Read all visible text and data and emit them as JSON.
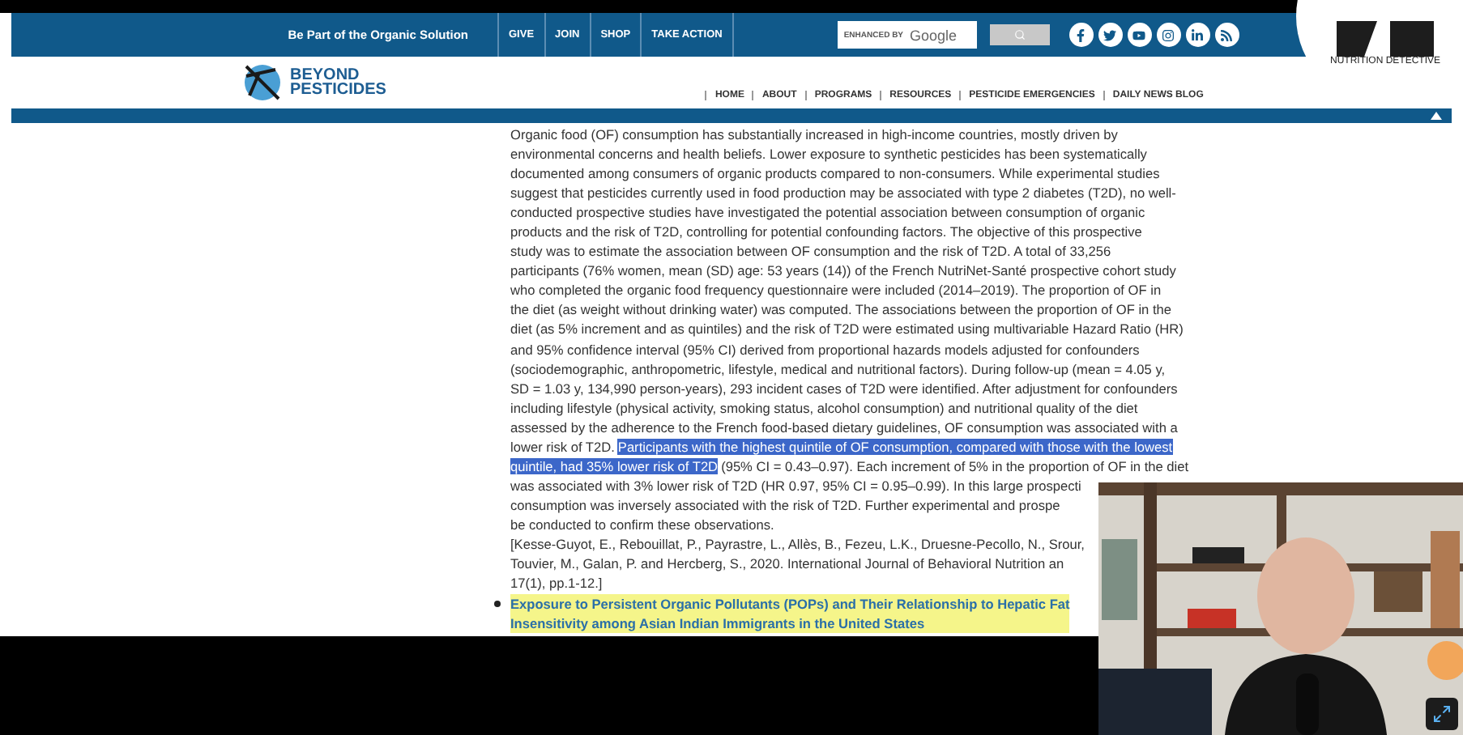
{
  "top_bar": {
    "slogan": "Be Part of the Organic Solution",
    "links": [
      "GIVE",
      "JOIN",
      "SHOP",
      "TAKE ACTION"
    ],
    "search": {
      "hint_label": "ENHANCED BY",
      "hint_brand": "Google"
    }
  },
  "badge": {
    "caption": "NUTRITION DETECTIVE"
  },
  "logo": {
    "line_1": "BEYOND",
    "line_2": "PESTICIDES"
  },
  "nav": [
    "HOME",
    "ABOUT",
    "PROGRAMS",
    "RESOURCES",
    "PESTICIDE EMERGENCIES",
    "DAILY NEWS BLOG"
  ],
  "article": {
    "lines": [
      [
        {
          "text": "Organic food (OF) consumption has substantially increased in high-income countries, mostly driven by",
          "selected": false
        }
      ],
      [
        {
          "text": "environmental concerns and health beliefs. Lower exposure to synthetic pesticides has been systematically",
          "selected": false
        }
      ],
      [
        {
          "text": "documented among consumers of organic products compared to non-consumers. While experimental studies",
          "selected": false
        }
      ],
      [
        {
          "text": "suggest that pesticides currently used in food production may be associated with type 2 diabetes (T2D), no well-",
          "selected": false
        }
      ],
      [
        {
          "text": "conducted prospective studies have investigated the potential association between consumption of organic",
          "selected": false
        }
      ],
      [
        {
          "text": "products and the risk of T2D, controlling for potential confounding factors. The objective of this prospective",
          "selected": false
        }
      ],
      [
        {
          "text": "study was to estimate the association between OF consumption and the risk of T2D. A total of 33,256",
          "selected": false
        }
      ],
      [
        {
          "text": "participants (76% women, mean (SD) age: 53 years (14)) of the French NutriNet-Santé prospective cohort study",
          "selected": false
        }
      ],
      [
        {
          "text": "who completed the organic food frequency questionnaire were included (2014–2019). The proportion of OF in",
          "selected": false
        }
      ],
      [
        {
          "text": "the diet (as weight without drinking water) was computed. The associations between the proportion of OF in the",
          "selected": false
        }
      ],
      [
        {
          "text": "diet (as 5% increment and as quintiles) and the risk of T2D were estimated using multivariable Hazard Ratio (HR)",
          "selected": false
        }
      ],
      [
        {
          "text": "and 95% confidence interval (95% CI) derived from proportional hazards models adjusted for confounders",
          "selected": false
        }
      ],
      [
        {
          "text": "(sociodemographic, anthropometric, lifestyle, medical and nutritional factors). During follow-up (mean = 4.05 y,",
          "selected": false
        }
      ],
      [
        {
          "text": "SD = 1.03 y, 134,990 person-years), 293 incident cases of T2D were identified. After adjustment for confounders",
          "selected": false
        }
      ],
      [
        {
          "text": "including lifestyle (physical activity, smoking status, alcohol consumption) and nutritional quality of the diet",
          "selected": false
        }
      ],
      [
        {
          "text": "assessed by the adherence to the French food-based dietary guidelines, OF consumption was associated with a",
          "selected": false
        }
      ],
      [
        {
          "text": "lower risk of T2D.",
          "selected": false
        },
        {
          "text": "Participants with the highest quintile of OF consumption, compared with those with the lowest",
          "selected": true
        }
      ],
      [
        {
          "text": "quintile, had 35% lower risk of T2D",
          "selected": true
        },
        {
          "text": "(95% CI = 0.43–0.97). Each increment of 5% in the proportion of OF in the diet",
          "selected": false
        }
      ],
      [
        {
          "text": "was associated with 3% lower risk of T2D (HR 0.97, 95% CI = 0.95–0.99). In this large prospecti",
          "selected": false
        }
      ],
      [
        {
          "text": "consumption was inversely associated with the risk of T2D. Further experimental and prospe",
          "selected": false
        }
      ],
      [
        {
          "text": "be conducted to confirm these observations.",
          "selected": false
        }
      ],
      [
        {
          "text": "[Kesse-Guyot, E., Rebouillat, P., Payrastre, L., Allès, B., Fezeu, L.K., Druesne-Pecollo, N., Srour,",
          "selected": false
        }
      ],
      [
        {
          "text": "Touvier, M., Galan, P. and Hercberg, S., 2020. International Journal of Behavioral Nutrition an",
          "selected": false
        }
      ],
      [
        {
          "text": "17(1), pp.1-12.]",
          "selected": false
        }
      ]
    ],
    "links": [
      {
        "lines": [
          "Exposure to Persistent Organic Pollutants (POPs) and Their Relationship to Hepatic Fat",
          "Insensitivity among Asian Indian Immigrants in the United States"
        ]
      }
    ]
  }
}
